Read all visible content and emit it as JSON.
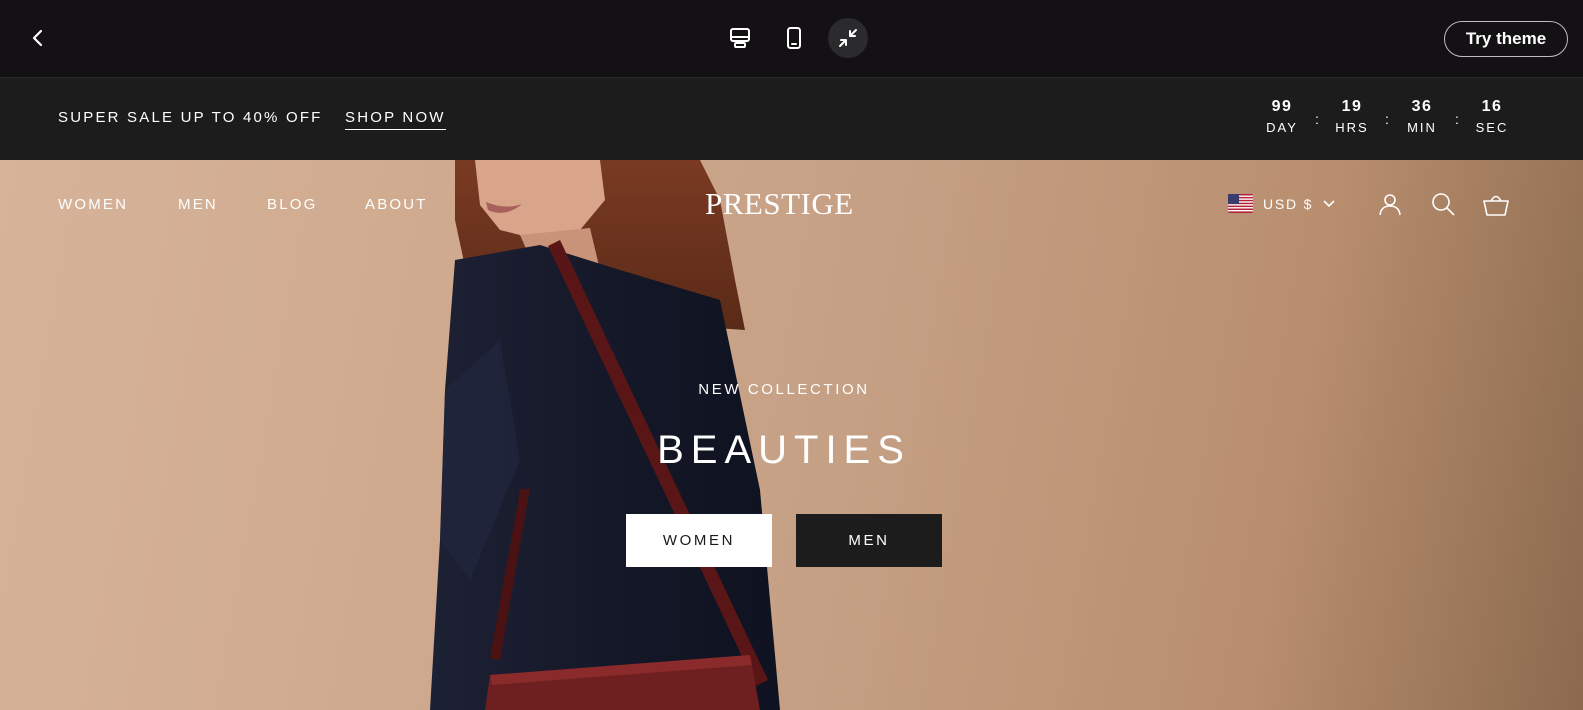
{
  "preview_bar": {
    "back_icon": "chevron-left-icon",
    "devices": [
      "desktop-icon",
      "mobile-icon",
      "collapse-icon"
    ],
    "try_theme_label": "Try theme"
  },
  "announcement": {
    "text": "SUPER SALE UP TO 40% OFF",
    "link_label": "SHOP NOW",
    "countdown": [
      {
        "value": "99",
        "label": "DAY"
      },
      {
        "value": "19",
        "label": "HRS"
      },
      {
        "value": "36",
        "label": "MIN"
      },
      {
        "value": "16",
        "label": "SEC"
      }
    ],
    "separator": ":"
  },
  "header": {
    "nav": [
      "WOMEN",
      "MEN",
      "BLOG",
      "ABOUT"
    ],
    "logo": "PRESTIGE",
    "currency": "USD $",
    "icons": [
      "account-icon",
      "search-icon",
      "cart-icon"
    ]
  },
  "hero": {
    "subtitle": "NEW COLLECTION",
    "title": "BEAUTIES",
    "buttons": [
      "WOMEN",
      "MEN"
    ]
  },
  "colors": {
    "topbar": "#131113",
    "announcement": "#1c1c1c",
    "hero_background": "#cfa98e",
    "jacket": "#161a2b",
    "bag": "#6e1f1f"
  }
}
